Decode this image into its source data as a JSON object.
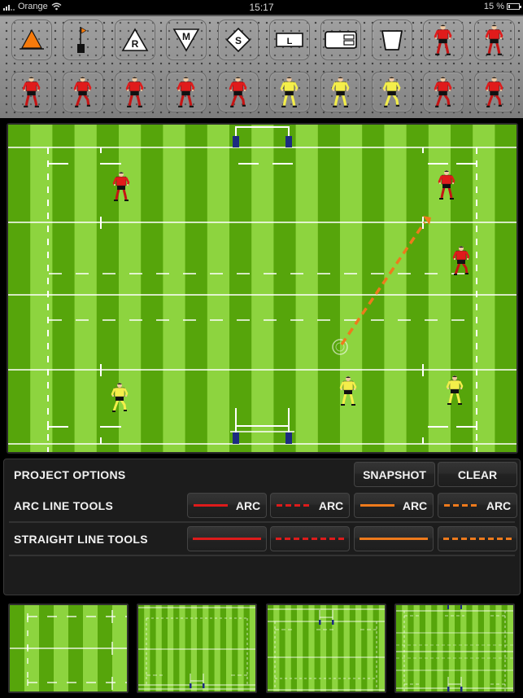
{
  "status_bar": {
    "carrier": "Orange",
    "time": "15:17",
    "battery_percent_label": "15 %",
    "battery_level": 0.15,
    "signal_icon": "signal-bars-icon",
    "wifi_icon": "wifi-icon",
    "battery_icon": "battery-charging-icon"
  },
  "toolbar": {
    "row1": [
      {
        "name": "cone",
        "icon": "orange-cone-icon"
      },
      {
        "name": "corner-flag",
        "icon": "corner-flag-icon"
      },
      {
        "name": "ruck-marker",
        "icon": "triangle-marker-icon",
        "letter": "R"
      },
      {
        "name": "maul-marker",
        "icon": "inverted-triangle-marker-icon",
        "letter": "M"
      },
      {
        "name": "scrum-marker",
        "icon": "diamond-marker-icon",
        "letter": "S"
      },
      {
        "name": "lineout-marker",
        "icon": "rectangle-marker-icon",
        "letter": "L"
      },
      {
        "name": "tackle-bag",
        "icon": "tackle-shield-icon"
      },
      {
        "name": "tackle-bucket",
        "icon": "bucket-icon"
      },
      {
        "name": "red-player-catching",
        "icon": "red-player-catching-icon"
      },
      {
        "name": "red-player-receiving",
        "icon": "red-player-receiving-icon"
      }
    ],
    "row2": [
      {
        "name": "red-player-back",
        "icon": "red-player-back-icon"
      },
      {
        "name": "red-player-running-side",
        "icon": "red-player-running-icon"
      },
      {
        "name": "red-player-stance-ball",
        "icon": "red-player-stance-icon"
      },
      {
        "name": "red-player-back-ball",
        "icon": "red-player-back-ball-icon"
      },
      {
        "name": "red-player-running-ball",
        "icon": "red-player-running-ball-icon"
      },
      {
        "name": "yellow-player-stance",
        "icon": "yellow-player-stance-icon"
      },
      {
        "name": "yellow-player-back",
        "icon": "yellow-player-back-icon"
      },
      {
        "name": "yellow-player-running-ball",
        "icon": "yellow-player-running-ball-icon"
      },
      {
        "name": "red-player-sprinting",
        "icon": "red-player-sprinting-icon"
      },
      {
        "name": "red-player-kicking",
        "icon": "red-player-kicking-icon"
      }
    ]
  },
  "field": {
    "colors": {
      "light": "#8dd43f",
      "dark": "#56a50b",
      "line": "#ffffff",
      "post_pad": "#1c2b80"
    },
    "players": [
      {
        "team": "red",
        "pose": "back-stance",
        "name": "red-player-1"
      },
      {
        "team": "red",
        "pose": "stance-ball",
        "name": "red-player-2"
      },
      {
        "team": "red",
        "pose": "running",
        "name": "red-player-3"
      },
      {
        "team": "yellow",
        "pose": "running",
        "name": "yellow-player-1"
      },
      {
        "team": "yellow",
        "pose": "stance",
        "name": "yellow-player-2"
      },
      {
        "team": "yellow",
        "pose": "stance",
        "name": "yellow-player-3"
      }
    ],
    "annotation": {
      "type": "straight-dashed-arrow",
      "color": "#ee7a1c"
    }
  },
  "panel": {
    "project_options_label": "PROJECT OPTIONS",
    "snapshot_label": "SNAPSHOT",
    "clear_label": "CLEAR",
    "arc_tools_label": "ARC LINE TOOLS",
    "straight_tools_label": "STRAIGHT LINE TOOLS",
    "arc_buttons": [
      {
        "label": "ARC",
        "color": "red",
        "style": "solid"
      },
      {
        "label": "ARC",
        "color": "red",
        "style": "dashed"
      },
      {
        "label": "ARC",
        "color": "orange",
        "style": "solid"
      },
      {
        "label": "ARC",
        "color": "orange",
        "style": "dashed"
      }
    ],
    "straight_buttons": [
      {
        "color": "red",
        "style": "solid"
      },
      {
        "color": "red",
        "style": "dashed"
      },
      {
        "color": "orange",
        "style": "solid"
      },
      {
        "color": "orange",
        "style": "dashed"
      }
    ],
    "colors": {
      "red": "#dd1b1b",
      "orange": "#ee7a1c"
    }
  },
  "thumbnails": [
    {
      "name": "pitch-zoomed-quarter"
    },
    {
      "name": "pitch-half-goal-bottom"
    },
    {
      "name": "pitch-half-goal-top"
    },
    {
      "name": "pitch-full"
    }
  ]
}
